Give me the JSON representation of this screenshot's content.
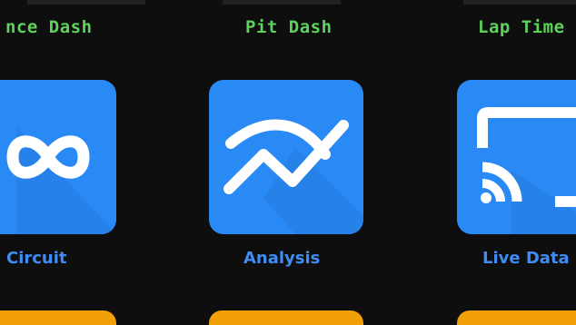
{
  "top_labels": {
    "left": "nce Dash",
    "center": "Pit Dash",
    "right": "Lap Time"
  },
  "tiles": [
    {
      "label": "Circuit",
      "icon": "infinity-icon"
    },
    {
      "label": "Analysis",
      "icon": "trend-chart-icon"
    },
    {
      "label": "Live Data",
      "icon": "cast-icon"
    }
  ],
  "colors": {
    "background": "#0e0e0e",
    "label_green": "#5cd35a",
    "tile_blue": "#2a8af5",
    "tile_label_blue": "#3f8cf2",
    "tile_orange": "#f2a007"
  }
}
